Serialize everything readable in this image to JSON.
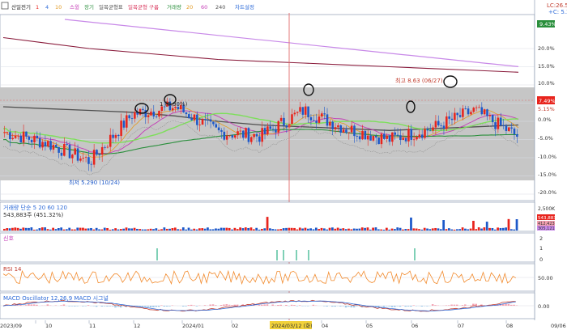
{
  "colors": {
    "background": "#ffffff",
    "band": "#c6c6c6",
    "candle_up": "#e8241d",
    "candle_down": "#1d58c9",
    "ma5": "#8a8a8a",
    "ma20": "#c43bb6",
    "ma60": "#e39a22",
    "ma120": "#2a8f3c",
    "ma240": "#505050",
    "long_ma": "#8a1c3c",
    "trend_purple": "#c889e8",
    "bright_green": "#7ddf5a",
    "rsi": "#f28a2c",
    "macd": "#c0392b",
    "signal": "#2e6bd8",
    "osc": "#f3a0b0",
    "grid": "#d9dde5"
  },
  "legend": {
    "title": "산일전기",
    "ma_labels": [
      "1",
      "4",
      "10",
      "스윙",
      "장기",
      "일목균형표",
      "일목균형 구름",
      "거래량",
      "20",
      "60",
      "240",
      "차트설정"
    ],
    "ma_colors": [
      "#e8241d",
      "#2e6bd8",
      "#e39a22",
      "#c43bb6",
      "#2a8f3c",
      "#505050",
      "#d8335a",
      "#2a8f3c",
      "#e39a22",
      "#c43bb6",
      "#505050",
      "#2e6bd8"
    ]
  },
  "top_right": {
    "line1": "LC:26.59",
    "line2": "+C: 5.39"
  },
  "price_axis": [
    "9.43%",
    "20.0%",
    "15.0%",
    "10.0%",
    "5.15%",
    "0.0%",
    "-5.0%",
    "-10.0%",
    "-15.0%",
    "-20.0%"
  ],
  "price_axis_values": [
    20.0,
    15.0,
    10.0,
    5.0,
    0.0,
    -5.0,
    -10.0,
    -15.0,
    -20.0
  ],
  "current_price_tag": "7.49%",
  "annotations": {
    "high": "최고 8.63 (06/27)",
    "low": "최저 5.290 (10/24)",
    "mid": "1 (6.90%)"
  },
  "volume_panel": {
    "title": "거래량 단순 5 20 60 120",
    "value": "543,883주 (451.32%)",
    "axis": [
      "2,500K",
      "2,000K",
      "1,500K",
      "1,000K",
      "500K"
    ],
    "tags": [
      "543,883",
      "412,423",
      "305,121"
    ]
  },
  "signal_panel": {
    "title": "신호",
    "axis": [
      "2",
      "1",
      "0"
    ]
  },
  "rsi_panel": {
    "title": "RSI 14",
    "axis": [
      "50.00"
    ]
  },
  "macd_panel": {
    "title": "MACD Oscillator 12,26,9 MACD 시그널",
    "axis": [
      "0.00"
    ]
  },
  "x_axis": [
    "2023/09",
    "10",
    "11",
    "12",
    "2024/01",
    "02",
    "2024/03/12 (화)",
    "04",
    "05",
    "06",
    "07",
    "08",
    "09/06"
  ],
  "chart_data": {
    "type": "line",
    "title": "산일전기",
    "x": [
      "2023/09",
      "10",
      "11",
      "12",
      "2024/01",
      "02",
      "03",
      "04",
      "05",
      "06",
      "07",
      "08",
      "09/06"
    ],
    "ylim": [
      -22,
      24
    ],
    "series": [
      {
        "name": "price",
        "values": [
          -3,
          -6,
          -11,
          2,
          4,
          -3,
          -4,
          3,
          -2,
          -5,
          -2,
          3,
          -4
        ]
      },
      {
        "name": "장기",
        "values": [
          17,
          15.5,
          14,
          13,
          12,
          11,
          10.5,
          10,
          9.5,
          9,
          8.5,
          8,
          7.5
        ]
      },
      {
        "name": "MA 240",
        "values": [
          4,
          3.5,
          3,
          2.5,
          1.5,
          0,
          -1,
          -1.5,
          -2,
          -2.5,
          -2,
          -1.5,
          -1
        ]
      }
    ]
  }
}
